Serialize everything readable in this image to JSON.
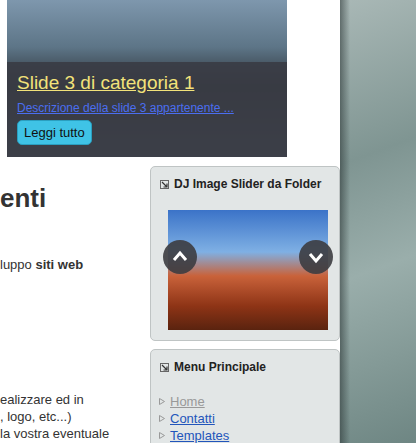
{
  "slideshow": {
    "title": "Slide 3 di categoria 1",
    "description": "Descrizione della slide 3 appartenente ...",
    "button": "Leggi tutto"
  },
  "content": {
    "heading": "enti",
    "paragraphs": [
      [
        [
          {
            "text": "luppo ",
            "bold": false
          },
          {
            "text": "siti web",
            "bold": true
          }
        ]
      ],
      [
        [
          {
            "text": "ealizzare ed in",
            "bold": false
          }
        ],
        [
          {
            "text": ", logo, etc...)",
            "bold": false
          }
        ],
        [
          {
            "text": "la vostra eventuale",
            "bold": false
          }
        ]
      ]
    ]
  },
  "modules": [
    {
      "title": "DJ Image Slider da Folder",
      "kind": "slider",
      "items": []
    },
    {
      "title": "Menu Principale",
      "kind": "menu",
      "items": [
        {
          "label": "Home",
          "current": true
        },
        {
          "label": "Contatti",
          "current": false
        },
        {
          "label": "Templates",
          "current": false
        }
      ]
    }
  ]
}
